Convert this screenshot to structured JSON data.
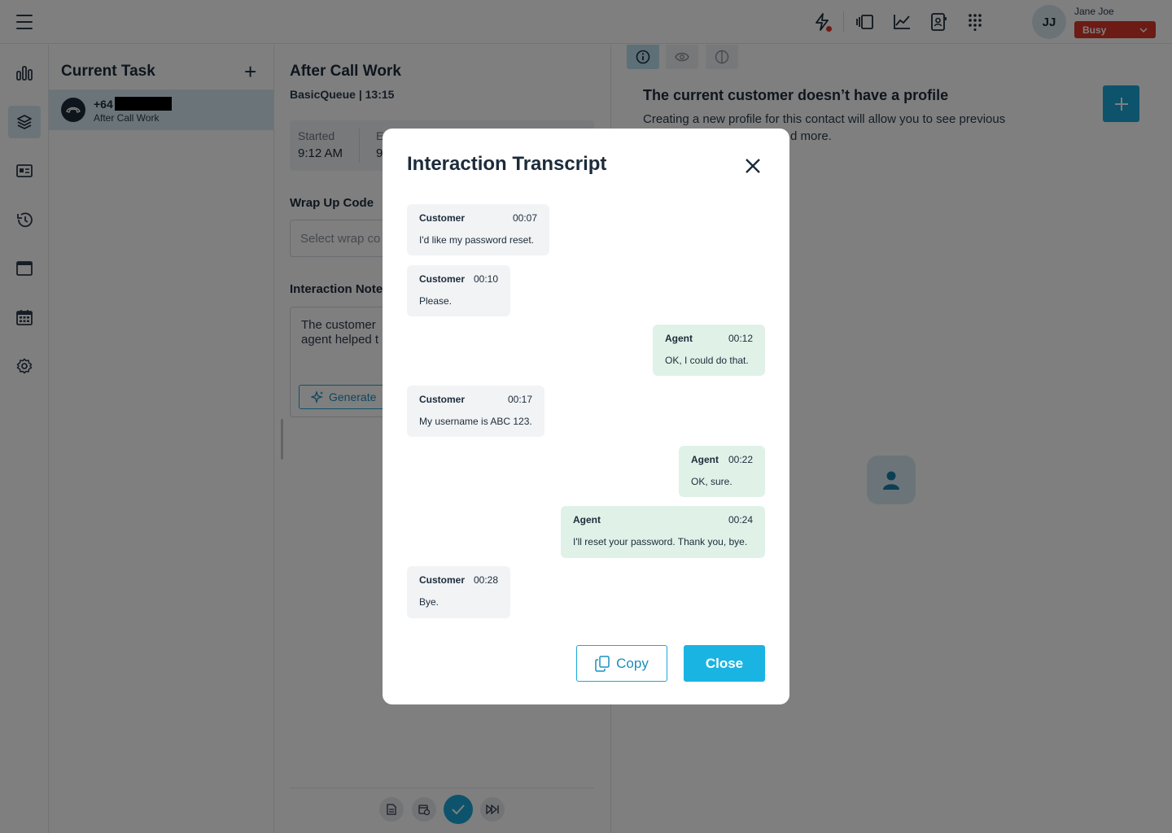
{
  "user": {
    "initials": "JJ",
    "name": "Jane Joe",
    "status": "Busy"
  },
  "task_panel": {
    "title": "Current Task",
    "task": {
      "number_prefix": "+64",
      "state": "After Call Work"
    }
  },
  "center": {
    "title": "After Call Work",
    "subtitle": "BasicQueue | 13:15",
    "started_label": "Started",
    "started_value": "9:12 AM",
    "ended_label": "E",
    "ended_value": "9",
    "wrap_label": "Wrap Up Code",
    "wrap_placeholder": "Select wrap co",
    "notes_label": "Interaction Note",
    "notes_text_line1": "The customer",
    "notes_text_line2": "agent helped t",
    "generate_label": "Generate"
  },
  "right": {
    "title": "The current customer doesn’t have a profile",
    "desc_line1": "Creating a new profile for this contact will allow you to see previous",
    "desc_line2": "d more."
  },
  "modal": {
    "title": "Interaction Transcript",
    "messages": [
      {
        "who": "Customer",
        "time": "00:07",
        "text": "I'd like my password reset."
      },
      {
        "who": "Customer",
        "time": "00:10",
        "text": "Please."
      },
      {
        "who": "Agent",
        "time": "00:12",
        "text": "OK, I could do that."
      },
      {
        "who": "Customer",
        "time": "00:17",
        "text": "My username is ABC 123."
      },
      {
        "who": "Agent",
        "time": "00:22",
        "text": "OK, sure."
      },
      {
        "who": "Agent",
        "time": "00:24",
        "text": "I'll reset your password. Thank you, bye."
      },
      {
        "who": "Customer",
        "time": "00:28",
        "text": "Bye."
      }
    ],
    "copy_label": "Copy",
    "close_label": "Close"
  },
  "colors": {
    "accent": "#1ab4e3",
    "busy": "#d8362a",
    "agent_bubble": "#e0f2e8",
    "customer_bubble": "#f1f3f5"
  }
}
